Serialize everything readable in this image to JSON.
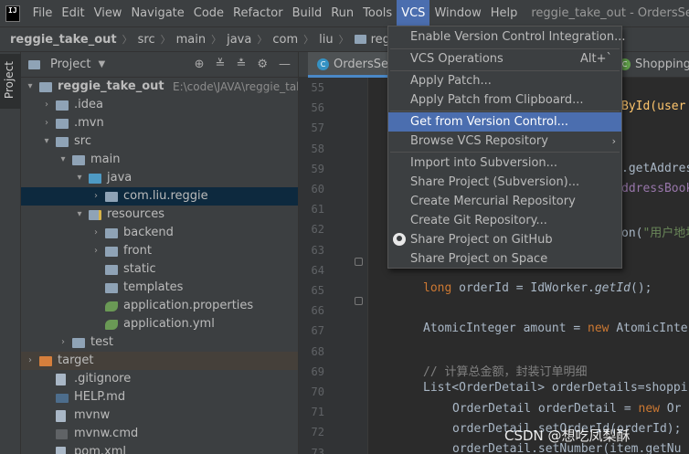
{
  "menubar": {
    "logo": "IJ",
    "items": [
      "File",
      "Edit",
      "View",
      "Navigate",
      "Code",
      "Refactor",
      "Build",
      "Run",
      "Tools",
      "VCS",
      "Window",
      "Help"
    ],
    "active_item": "VCS",
    "window_title": "reggie_take_out - OrdersServi"
  },
  "breadcrumb": [
    "reggie_take_out",
    "src",
    "main",
    "java",
    "com",
    "liu",
    "reggie"
  ],
  "left_strip": {
    "label": "Project"
  },
  "project_panel": {
    "title": "Project",
    "tree": [
      {
        "label": "reggie_take_out",
        "hint": "E:\\code\\JAVA\\reggie_take_o",
        "arrow": "▾",
        "icon": "folder",
        "bold": true
      },
      {
        "label": ".idea",
        "arrow": "›",
        "icon": "folder"
      },
      {
        "label": ".mvn",
        "arrow": "›",
        "icon": "folder"
      },
      {
        "label": "src",
        "arrow": "▾",
        "icon": "folder"
      },
      {
        "label": "main",
        "arrow": "▾",
        "icon": "folder"
      },
      {
        "label": "java",
        "arrow": "▾",
        "icon": "src"
      },
      {
        "label": "com.liu.reggie",
        "arrow": "›",
        "icon": "pkg",
        "selected": true
      },
      {
        "label": "resources",
        "arrow": "▾",
        "icon": "res"
      },
      {
        "label": "backend",
        "arrow": "›",
        "icon": "folder"
      },
      {
        "label": "front",
        "arrow": "›",
        "icon": "folder"
      },
      {
        "label": "static",
        "arrow": "",
        "icon": "folder"
      },
      {
        "label": "templates",
        "arrow": "",
        "icon": "folder"
      },
      {
        "label": "application.properties",
        "arrow": "",
        "icon": "leaf"
      },
      {
        "label": "application.yml",
        "arrow": "",
        "icon": "leaf"
      },
      {
        "label": "test",
        "arrow": "›",
        "icon": "folder"
      },
      {
        "label": "target",
        "arrow": "›",
        "icon": "target",
        "excluded": true
      },
      {
        "label": ".gitignore",
        "arrow": "",
        "icon": "file"
      },
      {
        "label": "HELP.md",
        "arrow": "",
        "icon": "md"
      },
      {
        "label": "mvnw",
        "arrow": "",
        "icon": "file"
      },
      {
        "label": "mvnw.cmd",
        "arrow": "",
        "icon": "cmd"
      },
      {
        "label": "pom.xml",
        "arrow": "",
        "icon": "file"
      }
    ]
  },
  "editor": {
    "tabs": [
      {
        "label": "OrdersSer",
        "icon": "C",
        "active": true
      },
      {
        "label": "ShoppingC",
        "icon": "C",
        "active": false
      }
    ],
    "line_numbers": [
      "55",
      "56",
      "57",
      "58",
      "59",
      "60",
      "61",
      "62",
      "63",
      "64",
      "65",
      "66",
      "67",
      "68",
      "69",
      "70",
      "71",
      "72",
      "73"
    ],
    "code": {
      "l56": "ById(user",
      "l59": ".getAddres",
      "l60": "ddressBook",
      "l62a": "on(",
      "l62b": "\"用户地址",
      "l65a": "long",
      "l65b": " orderId = IdWorker.",
      "l65c": "getId",
      "l65d": "();",
      "l67a": "AtomicInteger amount = ",
      "l67b": "new",
      "l67c": " AtomicInte",
      "l69": "// 计算总金额，封装订单明细",
      "l70": "List<OrderDetail> orderDetails=shoppi",
      "l71a": "OrderDetail orderDetail = ",
      "l71b": "new",
      "l71c": " Or",
      "l72a": "orderDetail.setOrderId(orderId);",
      "l73a": "orderDetail.setNumber(item.getNu"
    }
  },
  "vcs_menu": {
    "items": [
      {
        "label": "Enable Version Control Integration..."
      },
      {
        "label": "VCS Operations",
        "shortcut": "Alt+`"
      },
      {
        "label": "Apply Patch..."
      },
      {
        "label": "Apply Patch from Clipboard..."
      },
      {
        "label": "Get from Version Control...",
        "highlighted": true
      },
      {
        "label": "Browse VCS Repository",
        "submenu": "›"
      },
      {
        "label": "Import into Subversion..."
      },
      {
        "label": "Share Project (Subversion)..."
      },
      {
        "label": "Create Mercurial Repository"
      },
      {
        "label": "Create Git Repository..."
      },
      {
        "label": "Share Project on GitHub",
        "icon": "github-icon"
      },
      {
        "label": "Share Project on Space"
      }
    ]
  },
  "watermark": "CSDN @想吃凤梨酥"
}
